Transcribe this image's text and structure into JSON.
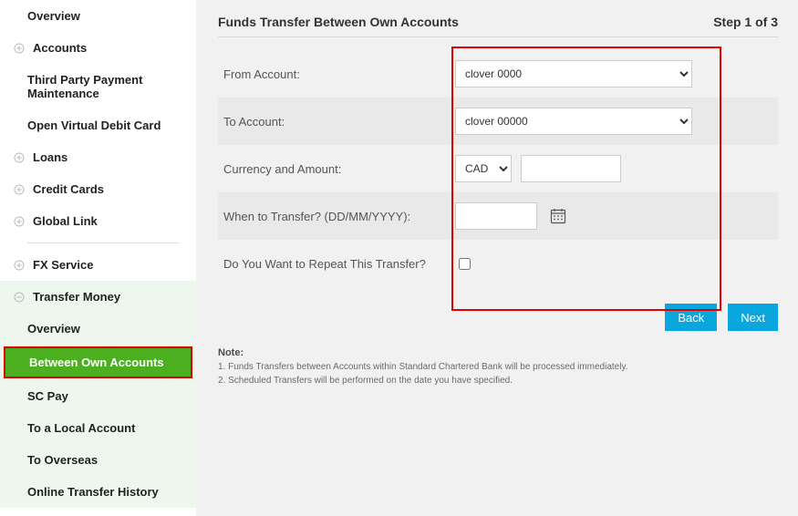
{
  "sidebar": {
    "overview": "Overview",
    "accounts": "Accounts",
    "third_party": "Third Party Payment Maintenance",
    "open_vdc": "Open Virtual Debit Card",
    "loans": "Loans",
    "credit_cards": "Credit Cards",
    "global_link": "Global Link",
    "fx_service": "FX Service",
    "transfer_money": "Transfer Money",
    "tm_overview": "Overview",
    "tm_between": "Between Own Accounts",
    "tm_scpay": "SC Pay",
    "tm_local": "To a Local Account",
    "tm_overseas": "To Overseas",
    "tm_history": "Online Transfer History"
  },
  "header": {
    "title": "Funds Transfer Between Own Accounts",
    "step": "Step 1 of 3"
  },
  "form": {
    "from_label": "From Account:",
    "from_value": "clover 0000",
    "to_label": "To Account:",
    "to_value": "clover 00000",
    "currency_label": "Currency and Amount:",
    "currency_value": "CAD",
    "amount_value": "",
    "when_label": "When to Transfer? (DD/MM/YYYY):",
    "date_value": "",
    "repeat_label": "Do You Want to Repeat This Transfer?"
  },
  "buttons": {
    "back": "Back",
    "next": "Next"
  },
  "notes": {
    "title": "Note:",
    "line1": "1. Funds Transfers between Accounts within Standard Chartered Bank will be processed immediately.",
    "line2": "2. Scheduled Transfers will be performed on the date you have specified."
  }
}
